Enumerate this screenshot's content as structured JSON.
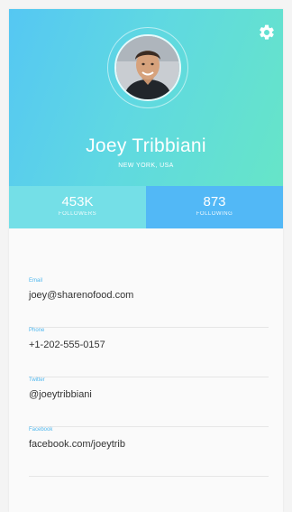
{
  "colors": {
    "gradient_start": "#55c7f3",
    "gradient_end": "#66e5c8",
    "followers_bg": "#74dfe7",
    "following_bg": "#52b8f6",
    "label_accent": "#4fb7ee"
  },
  "header": {
    "settings_icon": "gear-icon",
    "name": "Joey Tribbiani",
    "location": "NEW YORK, USA"
  },
  "stats": [
    {
      "value": "453K",
      "label": "FOLLOWERS"
    },
    {
      "value": "873",
      "label": "FOLLOWING"
    }
  ],
  "details": [
    {
      "label": "Email",
      "value": "joey@sharenofood.com"
    },
    {
      "label": "Phone",
      "value": "+1-202-555-0157"
    },
    {
      "label": "Twitter",
      "value": "@joeytribbiani"
    },
    {
      "label": "Facebook",
      "value": "facebook.com/joeytrib"
    }
  ]
}
